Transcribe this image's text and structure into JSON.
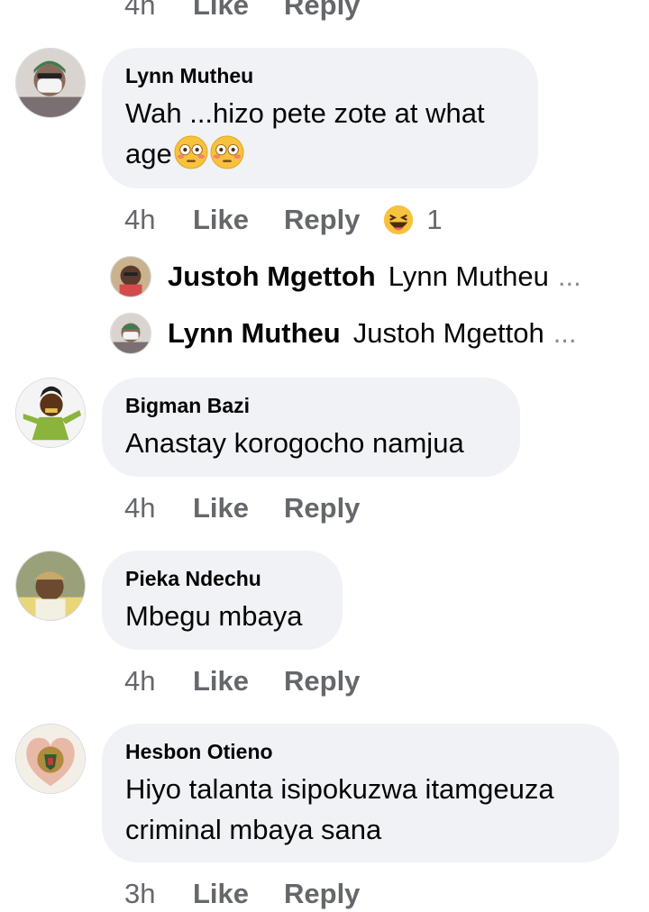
{
  "top_partial": {
    "time": "4h",
    "like": "Like",
    "reply": "Reply"
  },
  "comments": [
    {
      "author": "Lynn Mutheu",
      "text_line1": "Wah ...hizo pete zote at what",
      "text_line2": "age",
      "time": "4h",
      "like": "Like",
      "reply": "Reply",
      "reaction_count": "1",
      "replies": [
        {
          "author": "Justoh Mgettoh",
          "preview": "Lynn Mutheu",
          "ellipsis": "..."
        },
        {
          "author": "Lynn Mutheu",
          "preview": "Justoh Mgettoh",
          "ellipsis": "..."
        }
      ]
    },
    {
      "author": "Bigman Bazi",
      "text": "Anastay korogocho namjua",
      "time": "4h",
      "like": "Like",
      "reply": "Reply"
    },
    {
      "author": "Pieka Ndechu",
      "text": "Mbegu mbaya",
      "time": "4h",
      "like": "Like",
      "reply": "Reply"
    },
    {
      "author": "Hesbon Otieno",
      "text_line1": "Hiyo talanta isipokuzwa itamgeuza",
      "text_line2": "criminal mbaya sana",
      "time": "3h",
      "like": "Like",
      "reply": "Reply"
    }
  ],
  "colors": {
    "bubble": "#f0f2f5",
    "meta": "#65676b",
    "text": "#050505"
  }
}
